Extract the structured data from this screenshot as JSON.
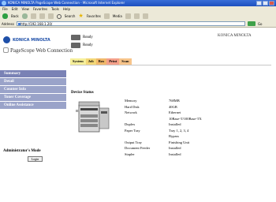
{
  "window": {
    "title": "KONICA MINOLTA PageScope Web Connection - Microsoft Internet Explorer",
    "menu": [
      "File",
      "Edit",
      "View",
      "Favorites",
      "Tools",
      "Help"
    ]
  },
  "toolbar": {
    "back_label": "Back",
    "search_label": "Search",
    "favorites_label": "Favorites",
    "media_label": "Media"
  },
  "address": {
    "label": "Address",
    "url": "http://192.168.1.20/",
    "go_label": "Go"
  },
  "header": {
    "brand": "KONICA MINOLTA",
    "app_name": "PageScope Web Connection",
    "status_lines": [
      "Ready",
      "Ready"
    ],
    "model": "KONICA MINOLTA"
  },
  "tabs": [
    "System",
    "Job",
    "Box",
    "Print",
    "Scan"
  ],
  "sidebar": {
    "items": [
      {
        "label": "Summary",
        "active": true
      },
      {
        "label": "Detail",
        "active": false
      },
      {
        "label": "Counter Info",
        "active": false
      },
      {
        "label": "Toner Coverage",
        "active": false
      },
      {
        "label": "Online Assistance",
        "active": false
      }
    ],
    "admin_label": "Administrator's Mode",
    "login_label": "Login"
  },
  "main": {
    "section_title": "Device Status",
    "specs": [
      {
        "label": "Memory",
        "value": "768MB"
      },
      {
        "label": "Hard Disk",
        "value": "40GB"
      },
      {
        "label": "Network",
        "value": "Ethernet\n10Base-T/100Base-TX"
      },
      {
        "label": "Duplex",
        "value": "Installed"
      },
      {
        "label": "Paper Tray",
        "value": "Tray 1, 2, 3, 4\nBypass"
      },
      {
        "label": "Output Tray",
        "value": "Finishing Unit"
      },
      {
        "label": "Document Feeder",
        "value": "Installed"
      },
      {
        "label": "Stapler",
        "value": "Installed"
      }
    ]
  },
  "colors": {
    "sidebar": "#9aa3c9",
    "sidebar_active": "#7a82b5",
    "brand": "#1e4fa8",
    "titlebar": "#1c4fbf"
  }
}
